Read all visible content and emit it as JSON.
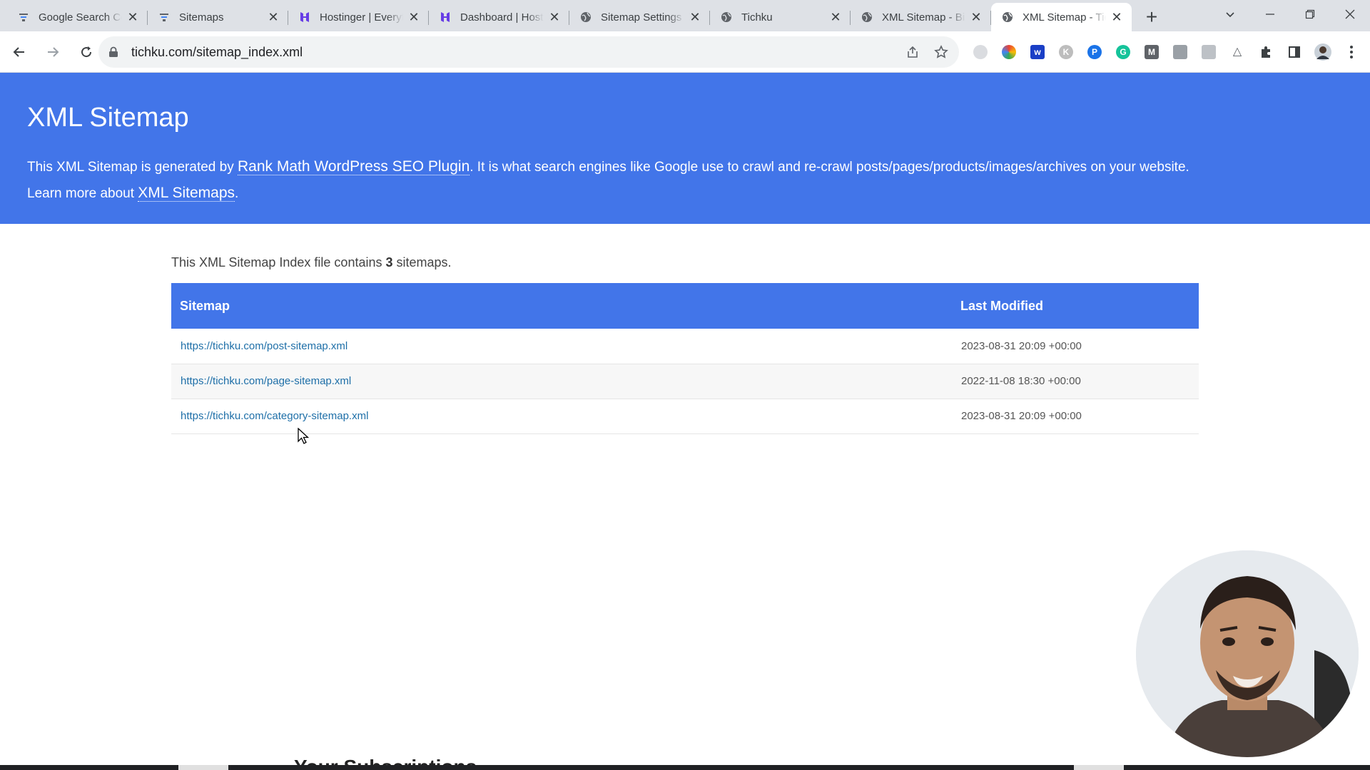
{
  "tabs": [
    {
      "title": "Google Search Console",
      "icon": "search-console-icon"
    },
    {
      "title": "Sitemaps",
      "icon": "search-console-icon"
    },
    {
      "title": "Hostinger | Everything",
      "icon": "hostinger-icon"
    },
    {
      "title": "Dashboard | Hostinger",
      "icon": "hostinger-icon"
    },
    {
      "title": "Sitemap Settings",
      "icon": "globe-icon"
    },
    {
      "title": "Tichku",
      "icon": "globe-icon"
    },
    {
      "title": "XML Sitemap - Bing",
      "icon": "globe-icon"
    },
    {
      "title": "XML Sitemap - Tichku",
      "icon": "globe-icon"
    }
  ],
  "browser": {
    "url": "tichku.com/sitemap_index.xml",
    "close_glyph": "✕",
    "new_tab_glyph": "+"
  },
  "header": {
    "title": "XML Sitemap",
    "desc_prefix": "This XML Sitemap is generated by ",
    "plugin_link": "Rank Math WordPress SEO Plugin",
    "desc_middle": ". It is what search engines like Google use to crawl and re-crawl posts/pages/products/images/archives on your website.",
    "learn_prefix": "Learn more about ",
    "learn_link": "XML Sitemaps",
    "learn_suffix": "."
  },
  "summary": {
    "prefix": "This XML Sitemap Index file contains ",
    "count": "3",
    "suffix": " sitemaps."
  },
  "table": {
    "headers": [
      "Sitemap",
      "Last Modified"
    ],
    "rows": [
      {
        "url": "https://tichku.com/post-sitemap.xml",
        "modified": "2023-08-31 20:09 +00:00"
      },
      {
        "url": "https://tichku.com/page-sitemap.xml",
        "modified": "2022-11-08 18:30 +00:00"
      },
      {
        "url": "https://tichku.com/category-sitemap.xml",
        "modified": "2023-08-31 20:09 +00:00"
      }
    ]
  },
  "overlay": {
    "bottom_text": "Your Subscriptions"
  },
  "colors": {
    "accent": "#4275e9",
    "link": "#1e6fa8"
  }
}
